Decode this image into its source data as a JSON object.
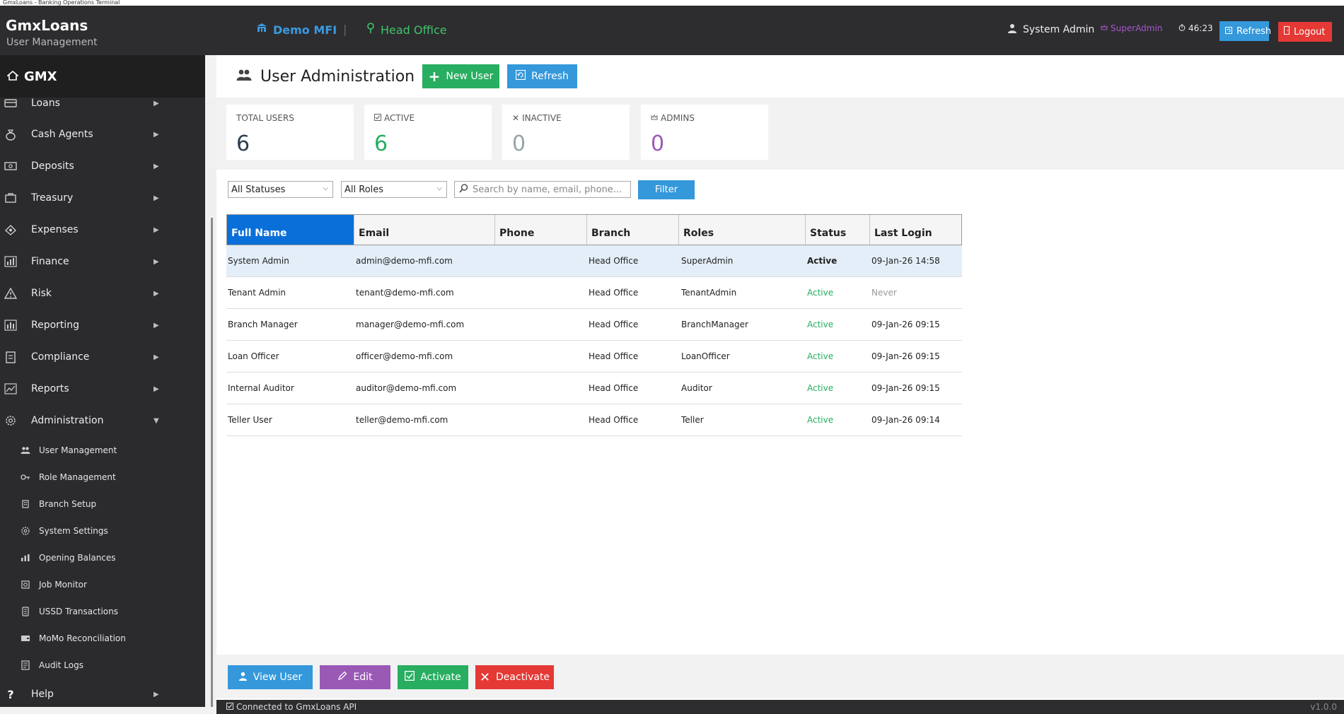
{
  "window": {
    "title": "GmxLoans - Banking Operations Terminal"
  },
  "header": {
    "app_name": "GmxLoans",
    "subtitle": "User Management",
    "org": "Demo MFI",
    "separator": "|",
    "branch": "Head Office",
    "user": "System Admin",
    "role": "SuperAdmin",
    "timer": "46:23",
    "refresh_label": "Refresh",
    "logout_label": "Logout"
  },
  "sidebar": {
    "brand": "GMX",
    "items": [
      {
        "label": "Loans",
        "icon": "loans-icon"
      },
      {
        "label": "Cash Agents",
        "icon": "cash-agents-icon"
      },
      {
        "label": "Deposits",
        "icon": "deposits-icon"
      },
      {
        "label": "Treasury",
        "icon": "treasury-icon"
      },
      {
        "label": "Expenses",
        "icon": "expenses-icon"
      },
      {
        "label": "Finance",
        "icon": "finance-icon"
      },
      {
        "label": "Risk",
        "icon": "risk-icon"
      },
      {
        "label": "Reporting",
        "icon": "reporting-icon"
      },
      {
        "label": "Compliance",
        "icon": "compliance-icon"
      },
      {
        "label": "Reports",
        "icon": "reports-icon"
      },
      {
        "label": "Administration",
        "icon": "administration-icon"
      }
    ],
    "sub_items": [
      {
        "label": "User Management"
      },
      {
        "label": "Role Management"
      },
      {
        "label": "Branch Setup"
      },
      {
        "label": "System Settings"
      },
      {
        "label": "Opening Balances"
      },
      {
        "label": "Job Monitor"
      },
      {
        "label": "USSD Transactions"
      },
      {
        "label": "MoMo Reconciliation"
      },
      {
        "label": "Audit Logs"
      }
    ],
    "help": "Help"
  },
  "page": {
    "title": "User Administration",
    "new_user_label": "New User",
    "refresh_label": "Refresh"
  },
  "stats": [
    {
      "label": "TOTAL USERS",
      "value": "6",
      "color": "#2c3e50"
    },
    {
      "label": "ACTIVE",
      "value": "6",
      "color": "#27ae60"
    },
    {
      "label": "INACTIVE",
      "value": "0",
      "color": "#95a5a6"
    },
    {
      "label": "ADMINS",
      "value": "0",
      "color": "#9b59b6"
    }
  ],
  "filters": {
    "status_selected": "All Statuses",
    "role_selected": "All Roles",
    "search_placeholder": "Search by name, email, phone...",
    "filter_label": "Filter"
  },
  "table": {
    "columns": [
      "Full Name",
      "Email",
      "Phone",
      "Branch",
      "Roles",
      "Status",
      "Last Login"
    ],
    "rows": [
      {
        "name": "System Admin",
        "email": "admin@demo-mfi.com",
        "phone": "",
        "branch": "Head Office",
        "roles": "SuperAdmin",
        "status": "Active",
        "last_login": "09-Jan-26 14:58"
      },
      {
        "name": "Tenant Admin",
        "email": "tenant@demo-mfi.com",
        "phone": "",
        "branch": "Head Office",
        "roles": "TenantAdmin",
        "status": "Active",
        "last_login": "Never"
      },
      {
        "name": "Branch Manager",
        "email": "manager@demo-mfi.com",
        "phone": "",
        "branch": "Head Office",
        "roles": "BranchManager",
        "status": "Active",
        "last_login": "09-Jan-26 09:15"
      },
      {
        "name": "Loan Officer",
        "email": "officer@demo-mfi.com",
        "phone": "",
        "branch": "Head Office",
        "roles": "LoanOfficer",
        "status": "Active",
        "last_login": "09-Jan-26 09:15"
      },
      {
        "name": "Internal Auditor",
        "email": "auditor@demo-mfi.com",
        "phone": "",
        "branch": "Head Office",
        "roles": "Auditor",
        "status": "Active",
        "last_login": "09-Jan-26 09:15"
      },
      {
        "name": "Teller User",
        "email": "teller@demo-mfi.com",
        "phone": "",
        "branch": "Head Office",
        "roles": "Teller",
        "status": "Active",
        "last_login": "09-Jan-26 09:14"
      }
    ]
  },
  "actions": {
    "view_label": "View User",
    "edit_label": "Edit",
    "activate_label": "Activate",
    "deactivate_label": "Deactivate"
  },
  "statusbar": {
    "text": "Connected to GmxLoans API",
    "version": "v1.0.0"
  },
  "colors": {
    "blue": "#3498db",
    "green": "#27ae60",
    "purple": "#9b59b6",
    "red": "#e53935",
    "active_green": "#27ae60"
  }
}
